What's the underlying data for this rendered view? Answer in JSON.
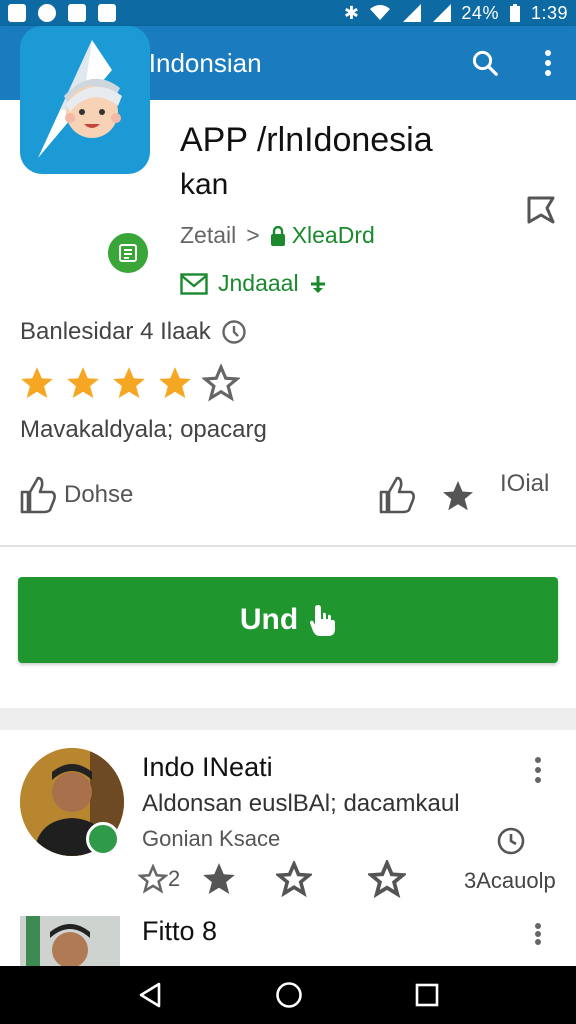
{
  "status_bar": {
    "battery": "24%",
    "time": "1:39"
  },
  "app_bar": {
    "title": "APP Indonsian"
  },
  "app": {
    "title_line1": "APP /rlnIdonesia",
    "title_line2": "kan",
    "developer_prefix": "Zetail",
    "developer_sep": ">",
    "developer_link": "XleaDrd",
    "install_label": "Jndaaal",
    "meta_text": "Banlesidar 4 Ilaak",
    "rating": 4,
    "rating_max": 5,
    "description": "Mavakaldyala; opacarg"
  },
  "actions": {
    "left_label": "Dohse",
    "right_label": "IOial"
  },
  "install_button": {
    "label": "Und"
  },
  "reviews": [
    {
      "name": "Indo INeati",
      "text": "Aldonsan euslBAl; dacamkaul",
      "sub": "Gonian Ksace",
      "icon_count": "2",
      "count_text": "3Acauolp"
    },
    {
      "name": "Fitto 8"
    }
  ],
  "colors": {
    "status_bar": "#0d6aa3",
    "app_bar": "#1a7bbf",
    "accent_green": "#1f962e",
    "star": "#f5a623"
  }
}
